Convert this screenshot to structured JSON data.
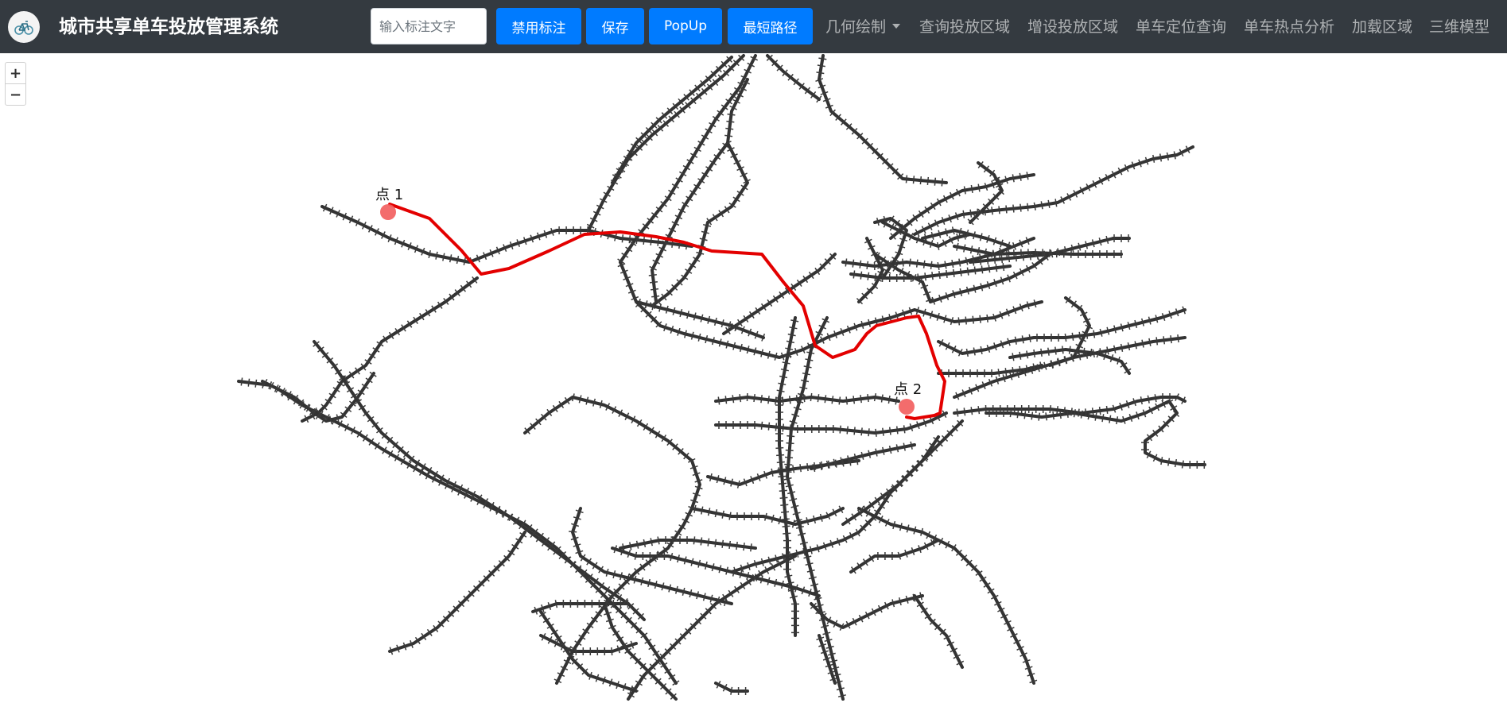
{
  "app": {
    "title": "城市共享单车投放管理系统",
    "logo_icon": "bicycle-logo-icon"
  },
  "toolbar": {
    "label_input_placeholder": "输入标注文字",
    "label_input_value": "",
    "disable_label_button": "禁用标注",
    "save_button": "保存",
    "popup_button": "PopUp",
    "shortest_path_button": "最短路径",
    "button_color": "#007bff"
  },
  "nav": {
    "geometry_draw": "几何绘制",
    "query_area": "查询投放区域",
    "add_area": "增设投放区域",
    "bike_locate": "单车定位查询",
    "hotspot": "单车热点分析",
    "load_area": "加载区域",
    "model_3d": "三维模型"
  },
  "map": {
    "zoom_in": "+",
    "zoom_out": "−",
    "road_color": "#333333",
    "route_color": "#e30000",
    "marker_color": "#f25c5c",
    "point1_label": "点 1",
    "point2_label": "点 2"
  }
}
